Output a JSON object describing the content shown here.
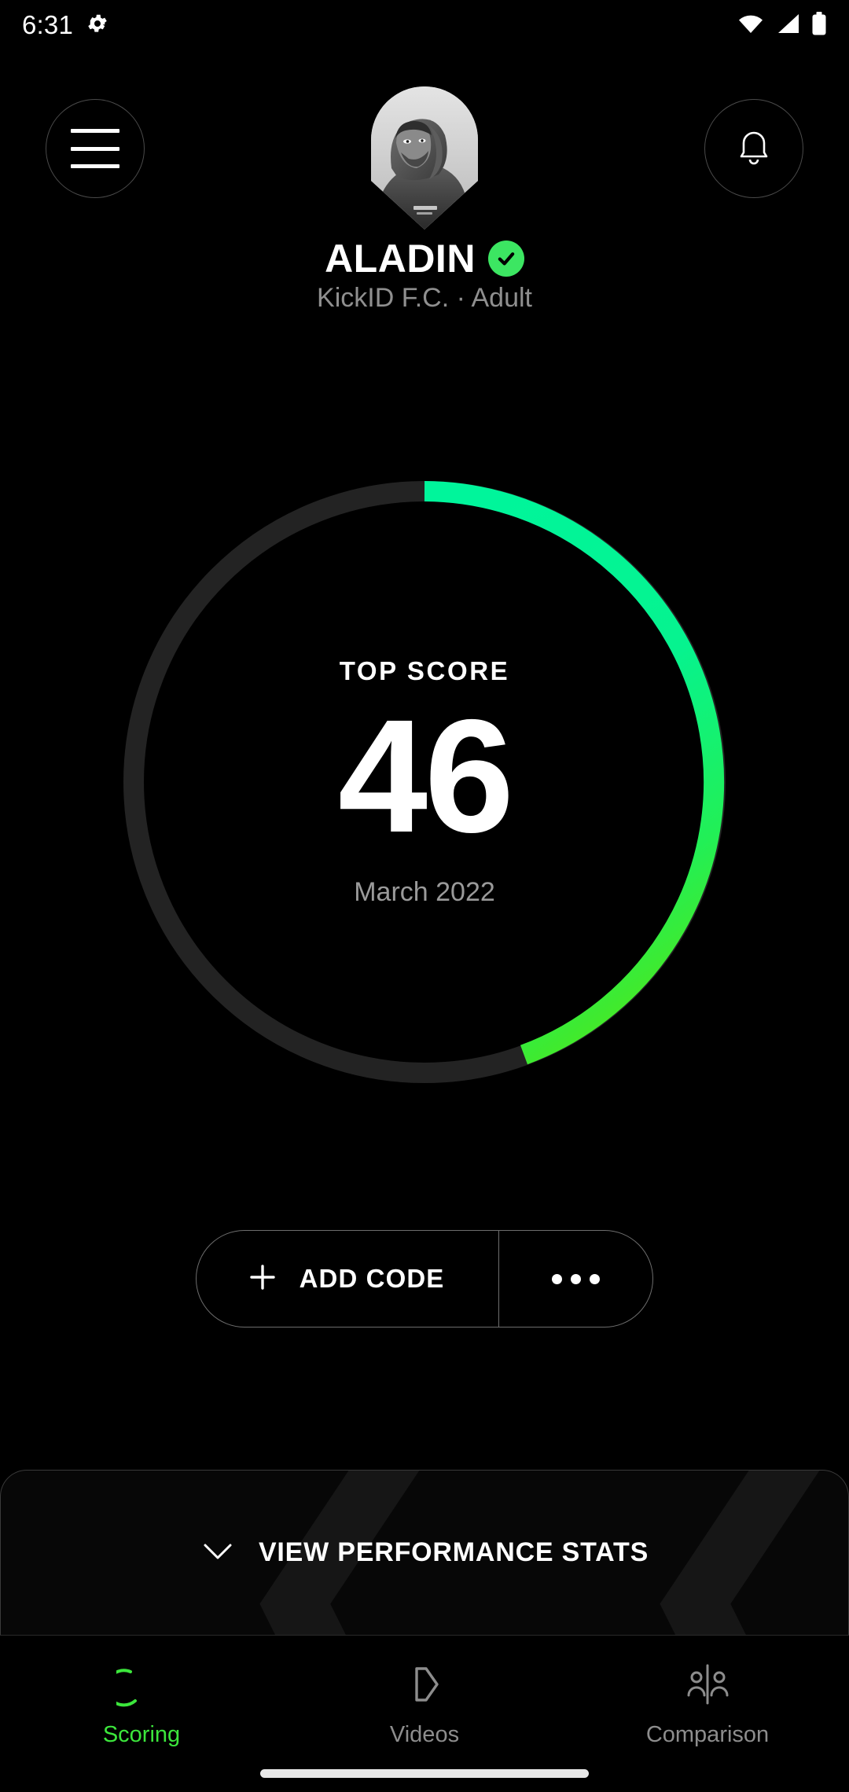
{
  "status_bar": {
    "time": "6:31",
    "icons": [
      "gear-icon",
      "wifi-icon",
      "cellular-signal-icon",
      "battery-icon"
    ]
  },
  "header": {
    "menu_icon": "hamburger-menu-icon",
    "notifications_icon": "bell-icon",
    "avatar_alt": "player-avatar-photo",
    "player_name": "ALADIN",
    "verified_icon": "verified-check-icon",
    "player_subtitle": "KickID F.C. · Adult"
  },
  "score_card": {
    "label": "TOP SCORE",
    "value": "46",
    "date": "March 2022"
  },
  "actions": {
    "add_code_label": "ADD CODE",
    "add_icon": "plus-icon",
    "more_icon": "more-horizontal-icon"
  },
  "sheet": {
    "expand_icon": "chevron-down-icon",
    "label": "VIEW PERFORMANCE STATS"
  },
  "bottom_nav": {
    "items": [
      {
        "label": "Scoring",
        "icon": "score-arc-icon",
        "active": true
      },
      {
        "label": "Videos",
        "icon": "play-pennant-icon",
        "active": false
      },
      {
        "label": "Comparison",
        "icon": "two-people-compare-icon",
        "active": false
      }
    ]
  },
  "colors": {
    "background": "#000000",
    "accent_green": "#00F59B",
    "accent_green_end": "#4CE81E",
    "nav_active": "#3CE63C",
    "verified_green": "#3CE662",
    "track_gray": "#232323",
    "muted_text": "#8F8F8F"
  },
  "chart_data": {
    "type": "gauge",
    "title": "TOP SCORE",
    "value": 46,
    "max": 100,
    "sweep_degrees": 160,
    "unit": "",
    "label_below": "March 2022",
    "track_color": "#232323",
    "gradient": [
      "#00F59B",
      "#4CE81E"
    ]
  }
}
